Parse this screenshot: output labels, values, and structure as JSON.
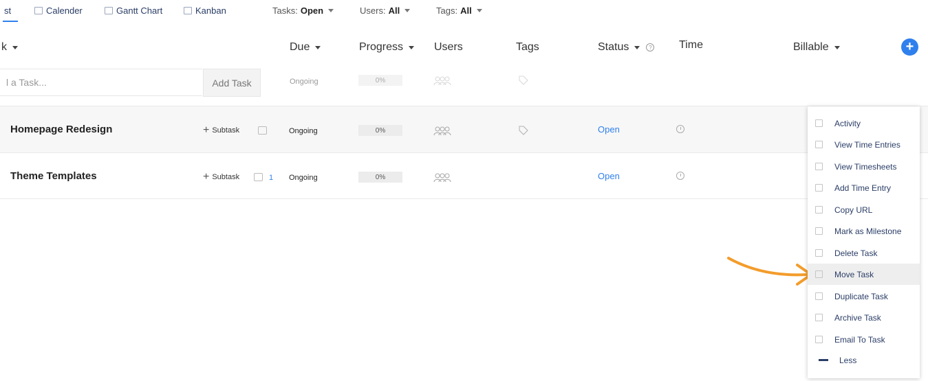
{
  "tabs": {
    "list": "st",
    "calendar": "Calender",
    "gantt": "Gantt Chart",
    "kanban": "Kanban"
  },
  "filters": {
    "tasks_label": "Tasks:",
    "tasks_value": "Open",
    "users_label": "Users:",
    "users_value": "All",
    "tags_label": "Tags:",
    "tags_value": "All"
  },
  "columns": {
    "task": "k",
    "due": "Due",
    "progress": "Progress",
    "users": "Users",
    "tags": "Tags",
    "status": "Status",
    "time": "Time",
    "billable": "Billable",
    "help": "?",
    "add": "+"
  },
  "add_row": {
    "placeholder": "l a Task...",
    "button": "Add Task",
    "due": "Ongoing",
    "progress": "0%"
  },
  "tasks": [
    {
      "name": "Homepage Redesign",
      "subtask": "Subtask",
      "subtask_plus": "+",
      "comments": "",
      "due": "Ongoing",
      "progress": "0%",
      "status": "Open"
    },
    {
      "name": "Theme Templates",
      "subtask": "Subtask",
      "subtask_plus": "+",
      "comments": "1",
      "due": "Ongoing",
      "progress": "0%",
      "status": "Open"
    }
  ],
  "menu": {
    "items": [
      "Activity",
      "View Time Entries",
      "View Timesheets",
      "Add Time Entry",
      "Copy URL",
      "Mark as Milestone",
      "Delete Task",
      "Move Task",
      "Duplicate Task",
      "Archive Task",
      "Email To Task"
    ],
    "less": "Less",
    "highlighted": "Move Task"
  },
  "colors": {
    "accent": "#2f80ed",
    "nav_text": "#2a3d66",
    "arrow": "#f39c2b"
  }
}
